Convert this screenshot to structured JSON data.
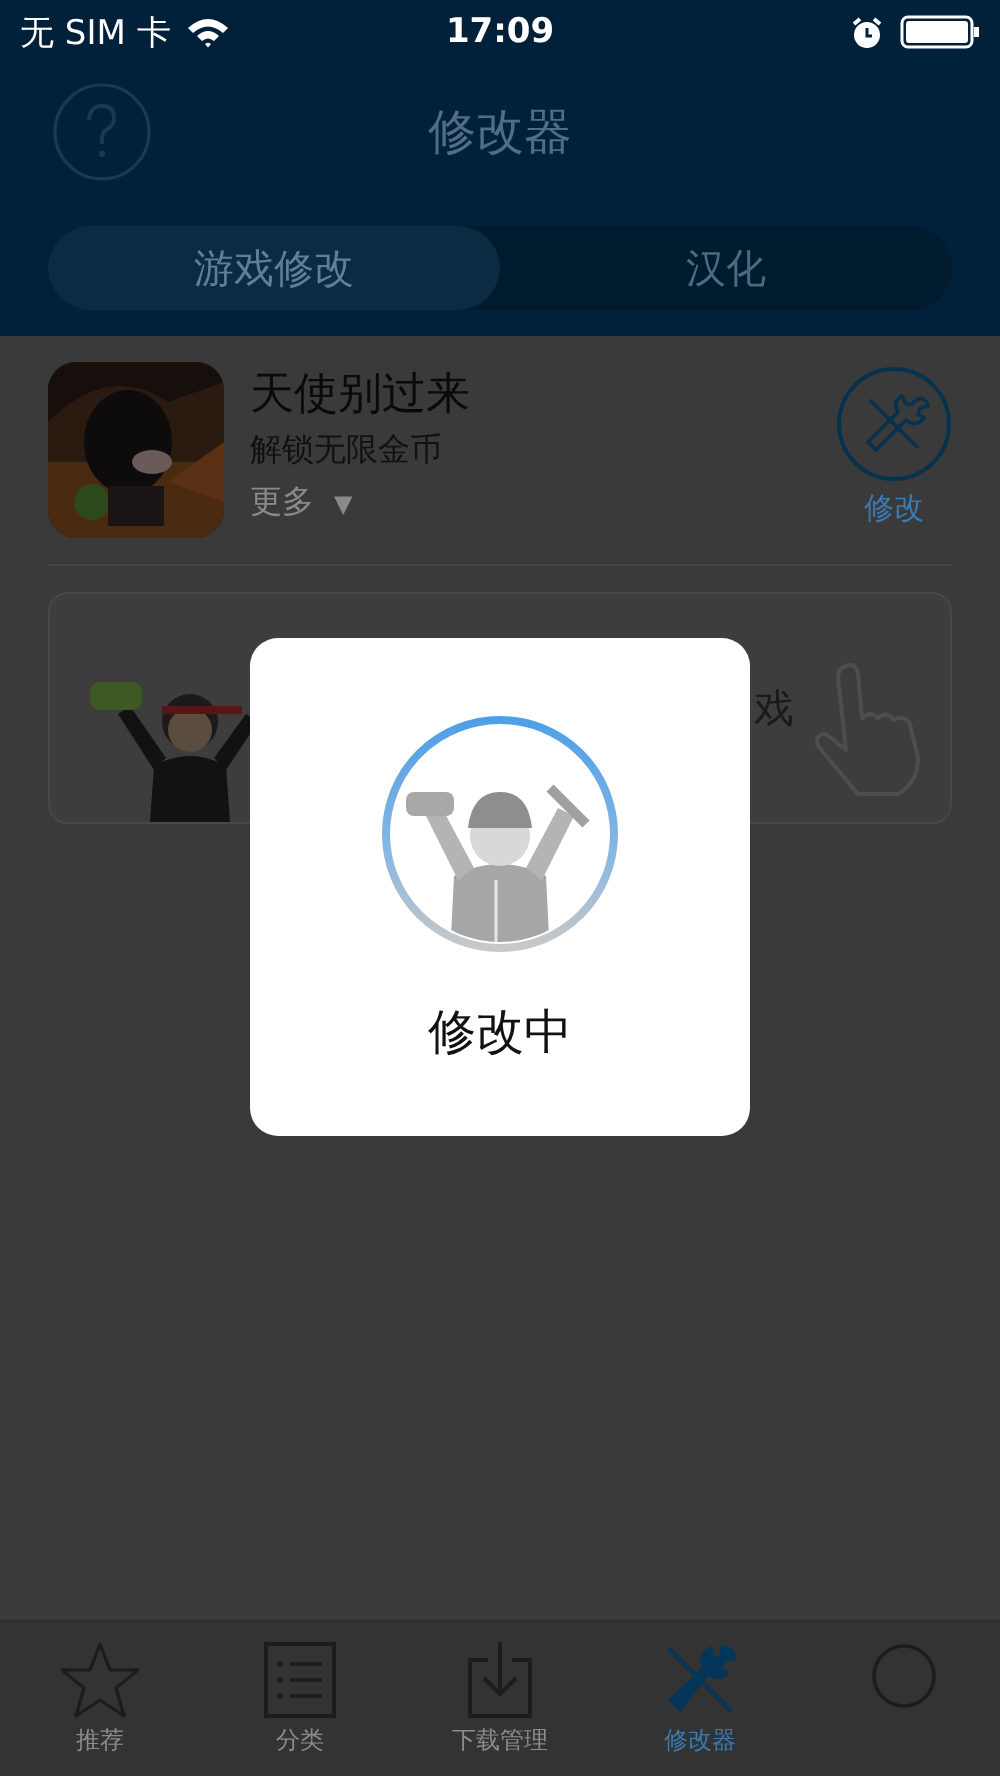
{
  "status_bar": {
    "carrier": "无 SIM 卡",
    "time": "17:09"
  },
  "nav_bar": {
    "title": "修改器"
  },
  "segments": [
    {
      "label": "游戏修改",
      "selected": true
    },
    {
      "label": "汉化",
      "selected": false
    }
  ],
  "games": [
    {
      "title": "天使别过来",
      "subtitle": "解锁无限金币",
      "more": "更多",
      "more_arrow": "▼",
      "action": "修改"
    }
  ],
  "banner": {
    "text": "戏"
  },
  "dialog": {
    "message": "修改中"
  },
  "tabs": [
    {
      "kind": "star",
      "label": "推荐",
      "selected": false
    },
    {
      "kind": "list",
      "label": "分类",
      "selected": false
    },
    {
      "kind": "download",
      "label": "下载管理",
      "selected": false
    },
    {
      "kind": "tools",
      "label": "修改器",
      "selected": true
    },
    {
      "kind": "circle",
      "selected": false
    }
  ]
}
